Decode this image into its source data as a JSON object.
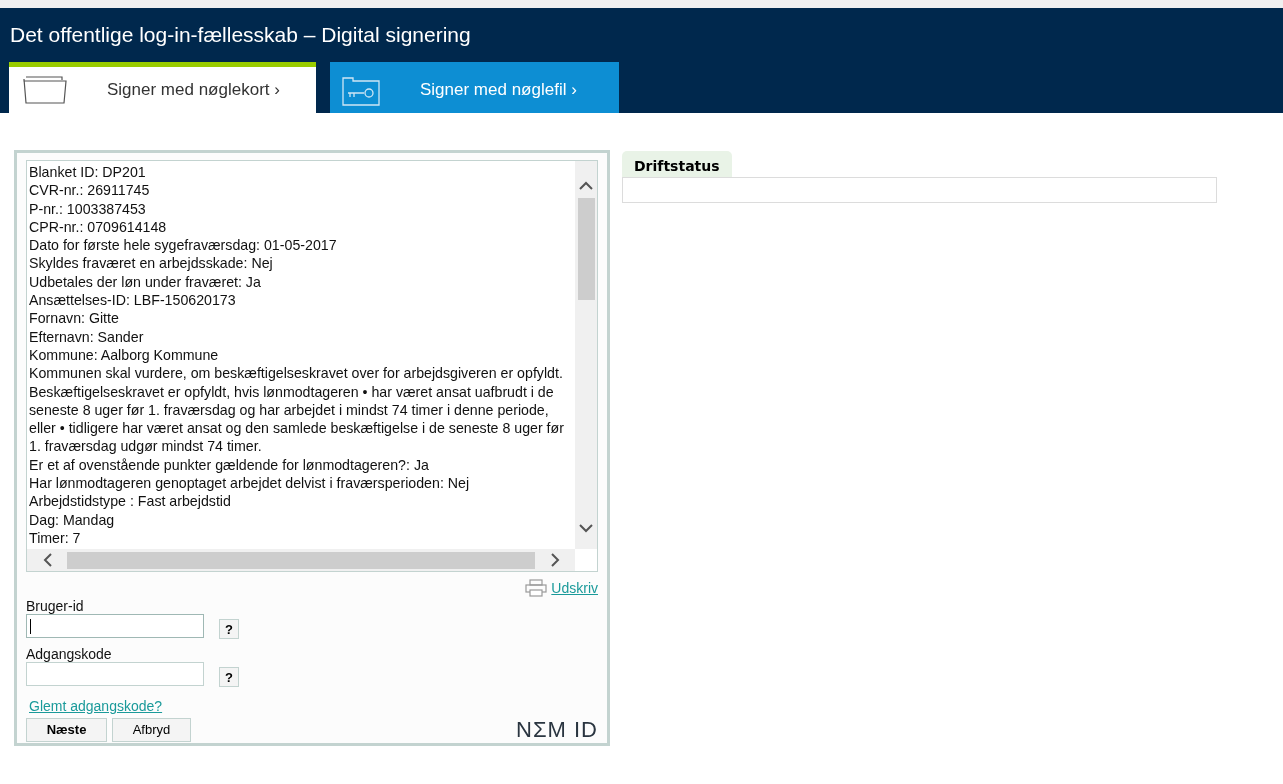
{
  "header": {
    "title": "Det offentlige log-in-fællesskab – Digital signering"
  },
  "tabs": [
    {
      "label": "Signer med nøglekort",
      "chevron": "›",
      "selected": true
    },
    {
      "label": "Signer med nøglefil",
      "chevron": "›",
      "selected": false
    }
  ],
  "document": {
    "lines": [
      "Blanket ID: DP201",
      "CVR-nr.: 26911745",
      "P-nr.: 1003387453",
      "CPR-nr.: 0709614148",
      "Dato for første hele sygefraværsdag: 01-05-2017",
      "Skyldes fraværet en arbejdsskade: Nej",
      "Udbetales der løn under fraværet: Ja",
      "Ansættelses-ID: LBF-150620173",
      "Fornavn: Gitte",
      "Efternavn: Sander",
      "Kommune: Aalborg Kommune",
      "Kommunen skal vurdere, om beskæftigelseskravet over for arbejdsgiveren er opfyldt. Beskæftigelseskravet er opfyldt, hvis lønmodtageren • har været ansat uafbrudt i de seneste 8 uger før 1. fraværsdag og har arbejdet i mindst 74 timer i denne periode, eller • tidligere har været ansat og den samlede beskæftigelse i de seneste 8 uger før 1. fraværsdag udgør mindst 74 timer.",
      "Er et af ovenstående punkter gældende for lønmodtageren?: Ja",
      "Har lønmodtageren genoptaget arbejdet delvist i fraværsperioden: Nej",
      "Arbejdstidstype : Fast arbejdstid",
      "Dag: Mandag",
      "Timer: 7"
    ]
  },
  "print_link": "Udskriv",
  "fields": [
    {
      "label": "Bruger-id",
      "help": "?",
      "focused": true
    },
    {
      "label": "Adgangskode",
      "help": "?",
      "focused": false
    }
  ],
  "forgot_link": "Glemt adgangskode?",
  "buttons": [
    {
      "label": "Næste",
      "primary": true
    },
    {
      "label": "Afbryd",
      "primary": false
    }
  ],
  "logo": "NΣM ID",
  "status": {
    "title": "Driftstatus"
  }
}
